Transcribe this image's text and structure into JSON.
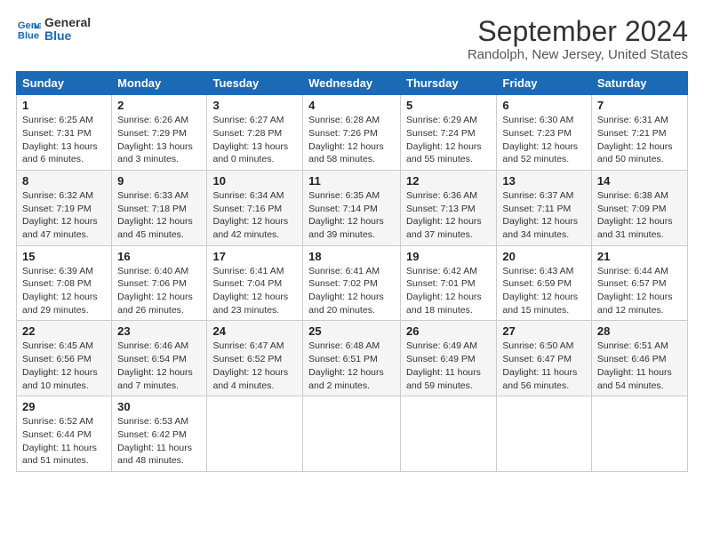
{
  "logo": {
    "line1": "General",
    "line2": "Blue"
  },
  "title": "September 2024",
  "location": "Randolph, New Jersey, United States",
  "days_of_week": [
    "Sunday",
    "Monday",
    "Tuesday",
    "Wednesday",
    "Thursday",
    "Friday",
    "Saturday"
  ],
  "weeks": [
    [
      {
        "day": "1",
        "sunrise": "6:25 AM",
        "sunset": "7:31 PM",
        "daylight": "13 hours and 6 minutes."
      },
      {
        "day": "2",
        "sunrise": "6:26 AM",
        "sunset": "7:29 PM",
        "daylight": "13 hours and 3 minutes."
      },
      {
        "day": "3",
        "sunrise": "6:27 AM",
        "sunset": "7:28 PM",
        "daylight": "13 hours and 0 minutes."
      },
      {
        "day": "4",
        "sunrise": "6:28 AM",
        "sunset": "7:26 PM",
        "daylight": "12 hours and 58 minutes."
      },
      {
        "day": "5",
        "sunrise": "6:29 AM",
        "sunset": "7:24 PM",
        "daylight": "12 hours and 55 minutes."
      },
      {
        "day": "6",
        "sunrise": "6:30 AM",
        "sunset": "7:23 PM",
        "daylight": "12 hours and 52 minutes."
      },
      {
        "day": "7",
        "sunrise": "6:31 AM",
        "sunset": "7:21 PM",
        "daylight": "12 hours and 50 minutes."
      }
    ],
    [
      {
        "day": "8",
        "sunrise": "6:32 AM",
        "sunset": "7:19 PM",
        "daylight": "12 hours and 47 minutes."
      },
      {
        "day": "9",
        "sunrise": "6:33 AM",
        "sunset": "7:18 PM",
        "daylight": "12 hours and 45 minutes."
      },
      {
        "day": "10",
        "sunrise": "6:34 AM",
        "sunset": "7:16 PM",
        "daylight": "12 hours and 42 minutes."
      },
      {
        "day": "11",
        "sunrise": "6:35 AM",
        "sunset": "7:14 PM",
        "daylight": "12 hours and 39 minutes."
      },
      {
        "day": "12",
        "sunrise": "6:36 AM",
        "sunset": "7:13 PM",
        "daylight": "12 hours and 37 minutes."
      },
      {
        "day": "13",
        "sunrise": "6:37 AM",
        "sunset": "7:11 PM",
        "daylight": "12 hours and 34 minutes."
      },
      {
        "day": "14",
        "sunrise": "6:38 AM",
        "sunset": "7:09 PM",
        "daylight": "12 hours and 31 minutes."
      }
    ],
    [
      {
        "day": "15",
        "sunrise": "6:39 AM",
        "sunset": "7:08 PM",
        "daylight": "12 hours and 29 minutes."
      },
      {
        "day": "16",
        "sunrise": "6:40 AM",
        "sunset": "7:06 PM",
        "daylight": "12 hours and 26 minutes."
      },
      {
        "day": "17",
        "sunrise": "6:41 AM",
        "sunset": "7:04 PM",
        "daylight": "12 hours and 23 minutes."
      },
      {
        "day": "18",
        "sunrise": "6:41 AM",
        "sunset": "7:02 PM",
        "daylight": "12 hours and 20 minutes."
      },
      {
        "day": "19",
        "sunrise": "6:42 AM",
        "sunset": "7:01 PM",
        "daylight": "12 hours and 18 minutes."
      },
      {
        "day": "20",
        "sunrise": "6:43 AM",
        "sunset": "6:59 PM",
        "daylight": "12 hours and 15 minutes."
      },
      {
        "day": "21",
        "sunrise": "6:44 AM",
        "sunset": "6:57 PM",
        "daylight": "12 hours and 12 minutes."
      }
    ],
    [
      {
        "day": "22",
        "sunrise": "6:45 AM",
        "sunset": "6:56 PM",
        "daylight": "12 hours and 10 minutes."
      },
      {
        "day": "23",
        "sunrise": "6:46 AM",
        "sunset": "6:54 PM",
        "daylight": "12 hours and 7 minutes."
      },
      {
        "day": "24",
        "sunrise": "6:47 AM",
        "sunset": "6:52 PM",
        "daylight": "12 hours and 4 minutes."
      },
      {
        "day": "25",
        "sunrise": "6:48 AM",
        "sunset": "6:51 PM",
        "daylight": "12 hours and 2 minutes."
      },
      {
        "day": "26",
        "sunrise": "6:49 AM",
        "sunset": "6:49 PM",
        "daylight": "11 hours and 59 minutes."
      },
      {
        "day": "27",
        "sunrise": "6:50 AM",
        "sunset": "6:47 PM",
        "daylight": "11 hours and 56 minutes."
      },
      {
        "day": "28",
        "sunrise": "6:51 AM",
        "sunset": "6:46 PM",
        "daylight": "11 hours and 54 minutes."
      }
    ],
    [
      {
        "day": "29",
        "sunrise": "6:52 AM",
        "sunset": "6:44 PM",
        "daylight": "11 hours and 51 minutes."
      },
      {
        "day": "30",
        "sunrise": "6:53 AM",
        "sunset": "6:42 PM",
        "daylight": "11 hours and 48 minutes."
      },
      null,
      null,
      null,
      null,
      null
    ]
  ],
  "labels": {
    "sunrise": "Sunrise:",
    "sunset": "Sunset:",
    "daylight": "Daylight:"
  }
}
